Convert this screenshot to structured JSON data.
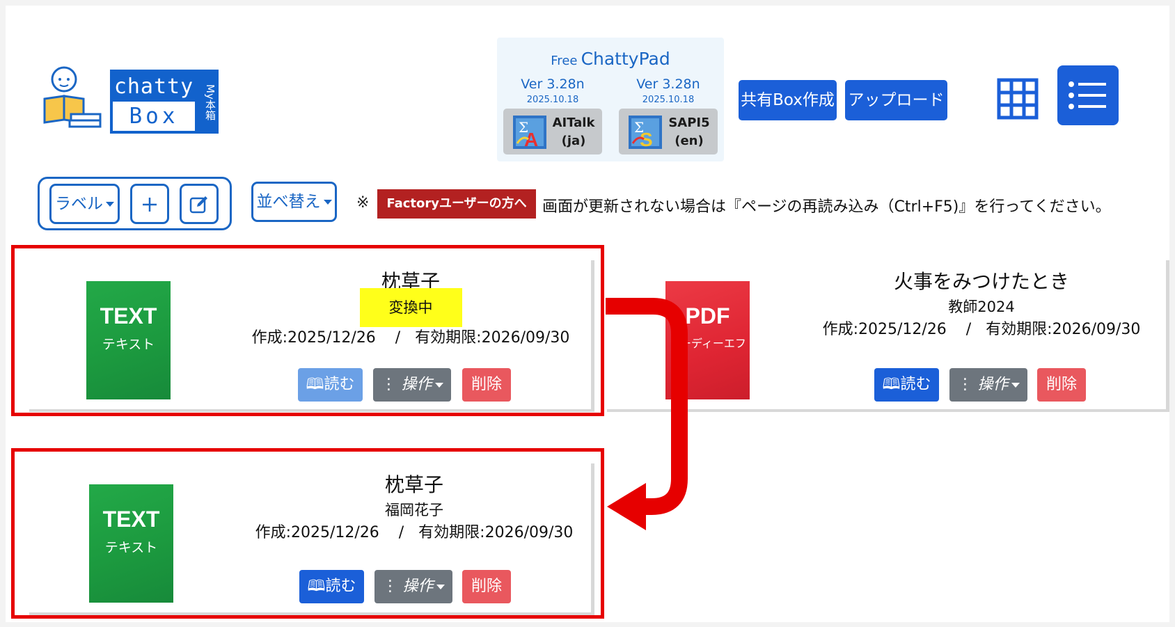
{
  "logo": {
    "top": "chatty",
    "bottom": "Box",
    "side": "My本箱"
  },
  "chattypad": {
    "free": "Free",
    "name": "ChattyPad",
    "apps": [
      {
        "version": "Ver 3.28n",
        "date": "2025.10.18",
        "label": "AITalk",
        "lang": "(ja)"
      },
      {
        "version": "Ver 3.28n",
        "date": "2025.10.18",
        "label": "SAPI5",
        "lang": "(en)"
      }
    ]
  },
  "header": {
    "shared_box_label": "共有Box作成",
    "upload_label": "アップロード"
  },
  "toolbar": {
    "label_dropdown": "ラベル",
    "sort_dropdown": "並べ替え",
    "notice_mark": "※",
    "factory_label": "Factoryユーザーの方へ",
    "notice_text": "画面が更新されない場合は『ページの再読み込み（Ctrl+F5)』を行ってください。"
  },
  "books": [
    {
      "cover_big": "TEXT",
      "cover_small": "テキスト",
      "title": "枕草子",
      "subtitle": "変換中",
      "dates": "作成:2025/12/26    /   有効期限:2026/09/30",
      "read_label": "読む",
      "ops_label": "操作",
      "delete_label": "削除"
    },
    {
      "cover_big": "PDF",
      "cover_small": "ピーディーエフ",
      "title": "火事をみつけたとき",
      "subtitle": "教師2024",
      "dates": "作成:2025/12/26    /   有効期限:2026/09/30",
      "read_label": "読む",
      "ops_label": "操作",
      "delete_label": "削除"
    },
    {
      "cover_big": "TEXT",
      "cover_small": "テキスト",
      "title": "枕草子",
      "subtitle": "福岡花子",
      "dates": "作成:2025/12/26    /   有効期限:2026/09/30",
      "read_label": "読む",
      "ops_label": "操作",
      "delete_label": "削除"
    }
  ],
  "colors": {
    "brand_blue": "#1b5fd8",
    "annotation_red": "#e60000",
    "highlight_yellow": "#ffff1a",
    "text_cover_green": "#1c9a3f",
    "pdf_cover_red": "#df2533"
  }
}
